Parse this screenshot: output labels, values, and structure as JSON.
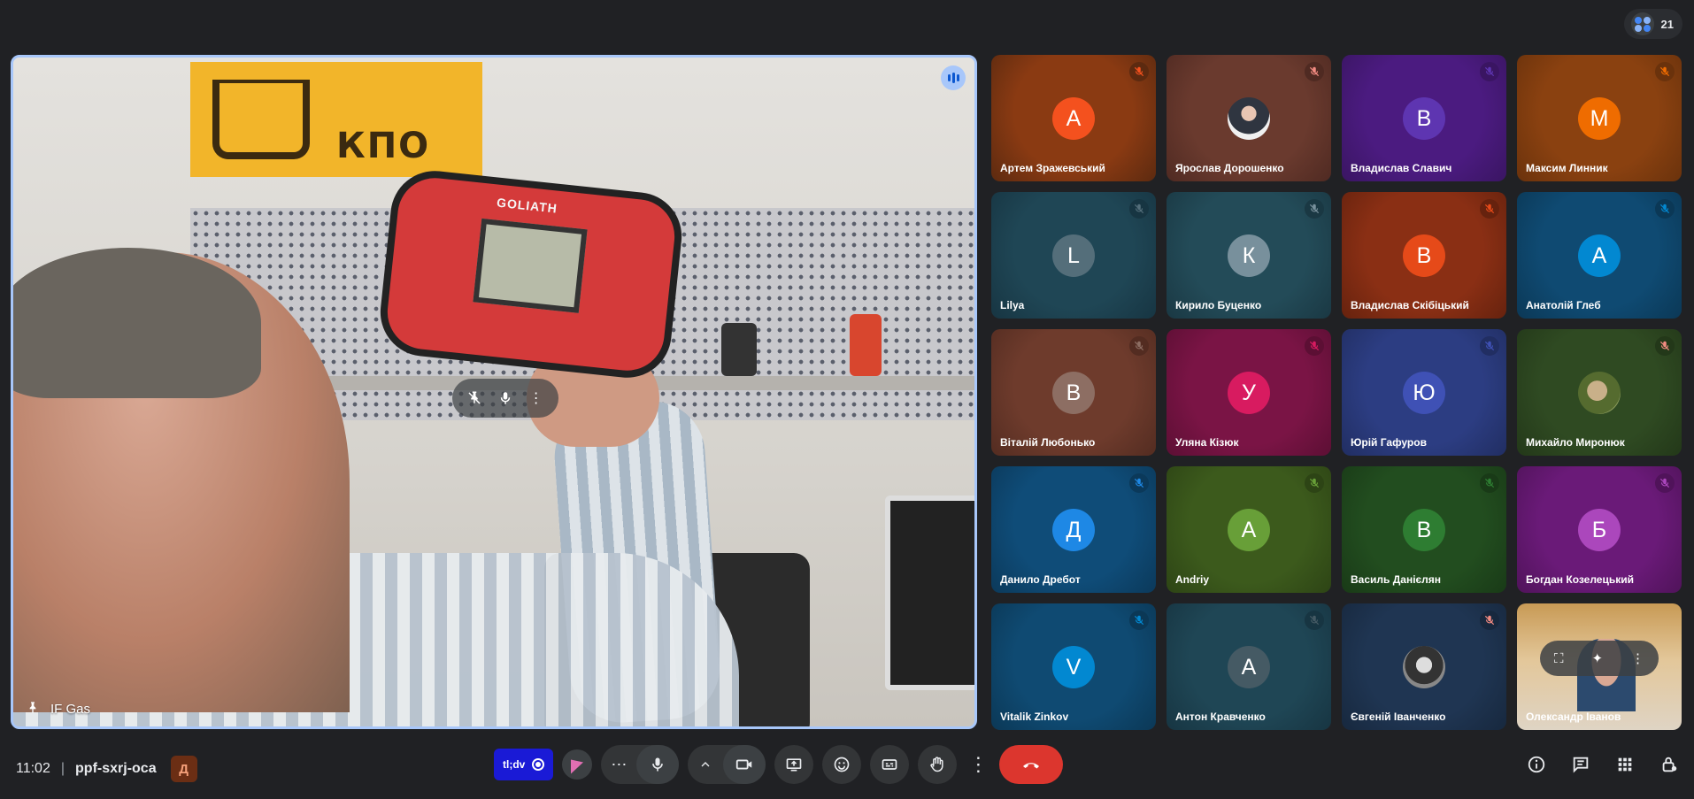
{
  "top": {
    "participant_count": "21"
  },
  "main": {
    "presenter_name": "IF Gas",
    "sign_text": "КПО",
    "device_brand": "GOLIATH"
  },
  "participants": [
    {
      "name": "Артем Зражевський",
      "initial": "А",
      "bg": "#8a3a12",
      "avatar_color": "#f4511e",
      "mic_tint": "#5c2a10"
    },
    {
      "name": "Ярослав Дорошенко",
      "initial": "",
      "bg": "#6a3a2e",
      "avatar_color": "#ffffff",
      "mic_tint": "#4f2a22",
      "photo": "face"
    },
    {
      "name": "Владислав Славич",
      "initial": "В",
      "bg": "#4b1b80",
      "avatar_color": "#5e35b1",
      "mic_tint": "#3a1562"
    },
    {
      "name": "Максим Линник",
      "initial": "М",
      "bg": "#8a4110",
      "avatar_color": "#ef6c00",
      "mic_tint": "#6a320c"
    },
    {
      "name": "Lilya",
      "initial": "L",
      "bg": "#1f4655",
      "avatar_color": "#546e7a",
      "mic_tint": "#173542"
    },
    {
      "name": "Кирило Буценко",
      "initial": "К",
      "bg": "#234b58",
      "avatar_color": "#78909c",
      "mic_tint": "#1a3843"
    },
    {
      "name": "Владислав Скібіцький",
      "initial": "В",
      "bg": "#8a2f14",
      "avatar_color": "#e64a19",
      "mic_tint": "#66220e"
    },
    {
      "name": "Анатолій Глеб",
      "initial": "А",
      "bg": "#0f4a72",
      "avatar_color": "#0288d1",
      "mic_tint": "#0b3856"
    },
    {
      "name": "Віталій Любонько",
      "initial": "В",
      "bg": "#6e3b2c",
      "avatar_color": "#8d6e63",
      "mic_tint": "#532c21"
    },
    {
      "name": "Уляна Кізюк",
      "initial": "У",
      "bg": "#7a1445",
      "avatar_color": "#d81b60",
      "mic_tint": "#5c0f34"
    },
    {
      "name": "Юрій Гафуров",
      "initial": "Ю",
      "bg": "#2c3d82",
      "avatar_color": "#3f51b5",
      "mic_tint": "#212e62"
    },
    {
      "name": "Михайло Миронюк",
      "initial": "",
      "bg": "#2f4a22",
      "avatar_color": "#ffffff",
      "mic_tint": "#233819",
      "photo": "green"
    },
    {
      "name": "Данило Дребот",
      "initial": "Д",
      "bg": "#0f4c78",
      "avatar_color": "#1e88e5",
      "mic_tint": "#0b395a"
    },
    {
      "name": "Andriy",
      "initial": "A",
      "bg": "#3c5a1c",
      "avatar_color": "#689f38",
      "mic_tint": "#2d4415"
    },
    {
      "name": "Василь Данієлян",
      "initial": "В",
      "bg": "#224d1f",
      "avatar_color": "#2e7d32",
      "mic_tint": "#193a17"
    },
    {
      "name": "Богдан Козелецький",
      "initial": "Б",
      "bg": "#6a1a78",
      "avatar_color": "#ab47bc",
      "mic_tint": "#50135a"
    },
    {
      "name": "Vitalik Zinkov",
      "initial": "V",
      "bg": "#0f4a72",
      "avatar_color": "#0288d1",
      "mic_tint": "#0b3856"
    },
    {
      "name": "Антон Кравченко",
      "initial": "А",
      "bg": "#1f4655",
      "avatar_color": "#455a64",
      "mic_tint": "#173542"
    },
    {
      "name": "Євгеній Іванченко",
      "initial": "",
      "bg": "#1f3552",
      "avatar_color": "#ffffff",
      "mic_tint": "#17283e",
      "photo": "bw"
    }
  ],
  "self": {
    "name": "Олександр Іванов"
  },
  "bottom": {
    "time": "11:02",
    "separator": "|",
    "meeting_code": "ppf-sxrj-oca",
    "host_badge": "Д",
    "extension_label": "tl;dv"
  }
}
